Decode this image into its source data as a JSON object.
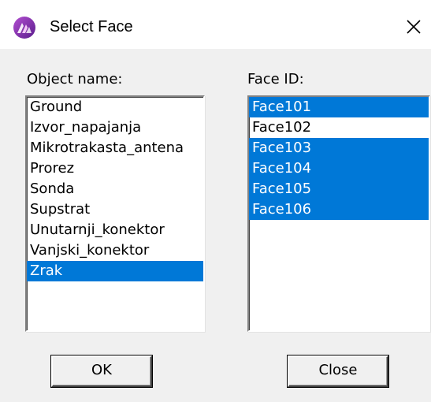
{
  "window": {
    "title": "Select Face",
    "close_glyph": "×"
  },
  "object_list": {
    "label": "Object name:",
    "items": [
      {
        "label": "Ground",
        "selected": false
      },
      {
        "label": "Izvor_napajanja",
        "selected": false
      },
      {
        "label": "Mikrotrakasta_antena",
        "selected": false
      },
      {
        "label": "Prorez",
        "selected": false
      },
      {
        "label": "Sonda",
        "selected": false
      },
      {
        "label": "Supstrat",
        "selected": false
      },
      {
        "label": "Unutarnji_konektor",
        "selected": false
      },
      {
        "label": "Vanjski_konektor",
        "selected": false
      },
      {
        "label": "Zrak",
        "selected": true
      }
    ]
  },
  "face_list": {
    "label": "Face ID:",
    "items": [
      {
        "label": "Face101",
        "selected": true
      },
      {
        "label": "Face102",
        "selected": false
      },
      {
        "label": "Face103",
        "selected": true
      },
      {
        "label": "Face104",
        "selected": true
      },
      {
        "label": "Face105",
        "selected": true
      },
      {
        "label": "Face106",
        "selected": true
      }
    ]
  },
  "buttons": {
    "ok_label": "OK",
    "close_label": "Close"
  },
  "colors": {
    "selection": "#0078d7",
    "dialog_bg": "#f0f0f0",
    "titlebar_bg": "#ffffff"
  },
  "icons": {
    "app": "app-logo-icon",
    "close": "close-icon"
  }
}
